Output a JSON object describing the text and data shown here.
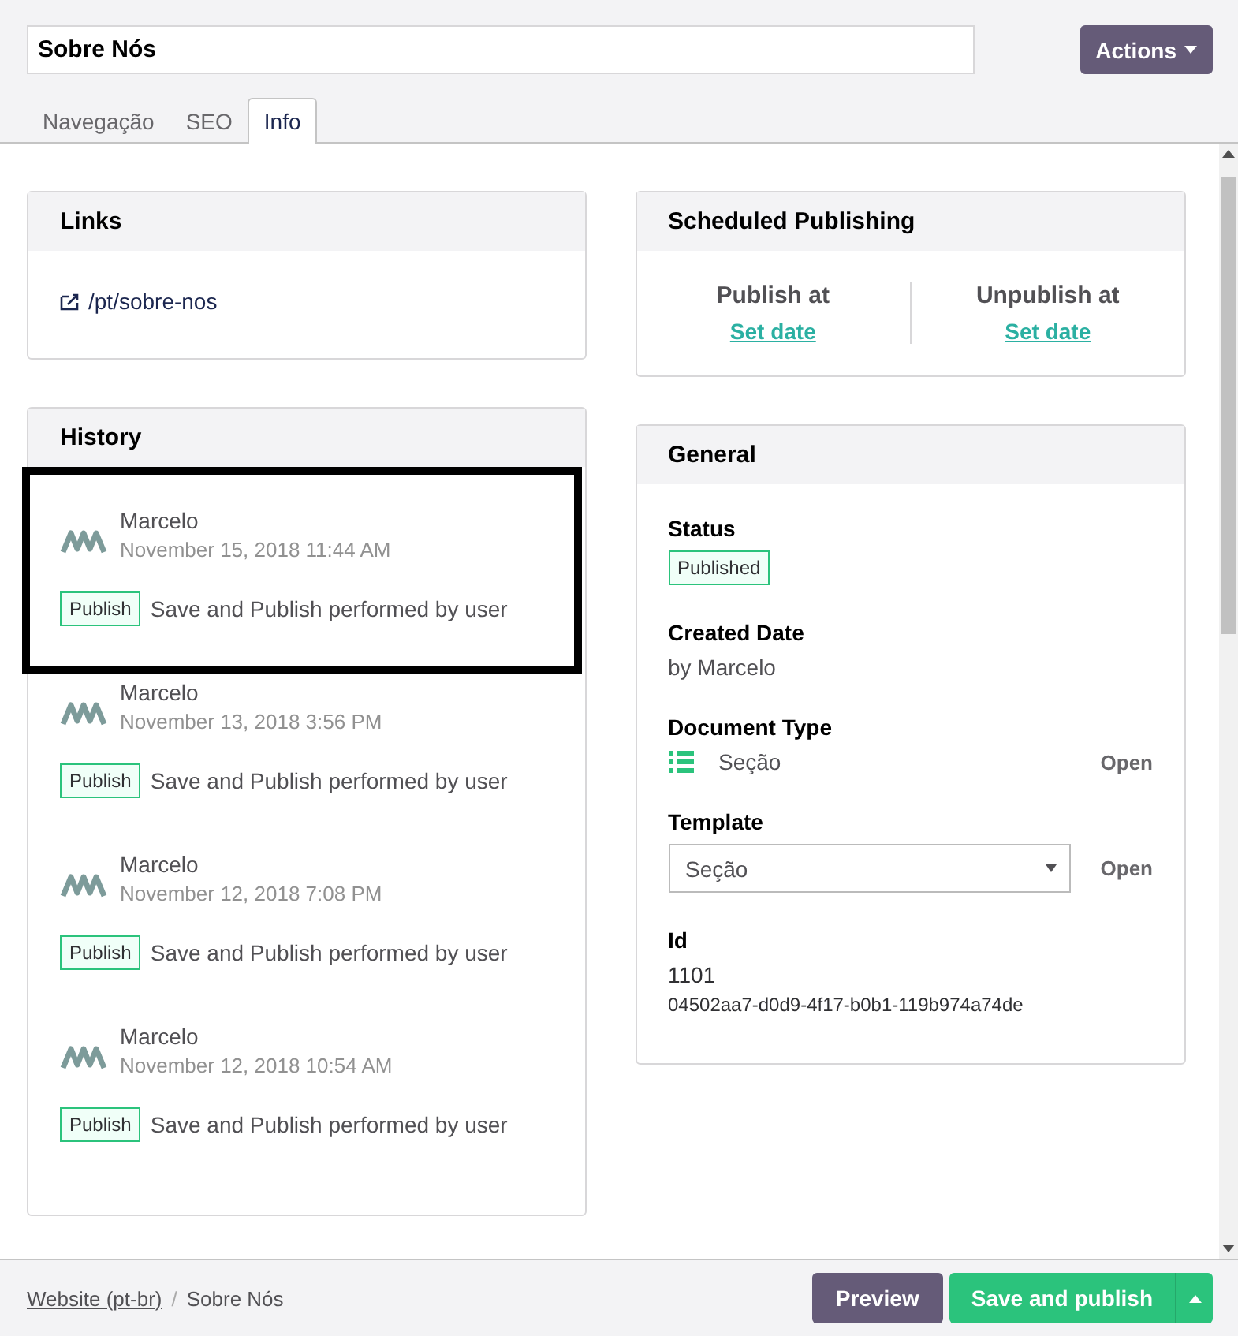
{
  "header": {
    "title_value": "Sobre Nós",
    "actions_button": "Actions"
  },
  "tabs": [
    {
      "label": "Navegação",
      "selected": false
    },
    {
      "label": "SEO",
      "selected": false
    },
    {
      "label": "Info",
      "selected": true
    }
  ],
  "links": {
    "title": "Links",
    "items": [
      "/pt/sobre-nos"
    ]
  },
  "history": {
    "title": "History",
    "entries": [
      {
        "user": "Marcelo",
        "date": "November 15, 2018 11:44 AM",
        "badge": "Publish",
        "message": "Save and Publish performed by user",
        "highlighted": true
      },
      {
        "user": "Marcelo",
        "date": "November 13, 2018 3:56 PM",
        "badge": "Publish",
        "message": "Save and Publish performed by user",
        "highlighted": false
      },
      {
        "user": "Marcelo",
        "date": "November 12, 2018 7:08 PM",
        "badge": "Publish",
        "message": "Save and Publish performed by user",
        "highlighted": false
      },
      {
        "user": "Marcelo",
        "date": "November 12, 2018 10:54 AM",
        "badge": "Publish",
        "message": "Save and Publish performed by user",
        "highlighted": false
      }
    ]
  },
  "scheduled": {
    "title": "Scheduled Publishing",
    "columns": [
      {
        "label": "Publish at",
        "link": "Set date"
      },
      {
        "label": "Unpublish at",
        "link": "Set date"
      }
    ]
  },
  "general": {
    "title": "General",
    "status_label": "Status",
    "status": "Published",
    "created_label": "Created Date",
    "created_by": "by Marcelo",
    "doctype_label": "Document Type",
    "doctype": "Seção",
    "doctype_open": "Open",
    "template_label": "Template",
    "template_value": "Seção",
    "template_open": "Open",
    "id_label": "Id",
    "id": "1101",
    "guid": "04502aa7-d0d9-4f17-b0b1-119b974a74de"
  },
  "footer": {
    "breadcrumb": [
      {
        "label": "Website (pt-br)",
        "link": true
      },
      {
        "label": "Sobre Nós",
        "link": false
      }
    ],
    "separator": "/",
    "preview_button": "Preview",
    "save_button": "Save and publish"
  }
}
